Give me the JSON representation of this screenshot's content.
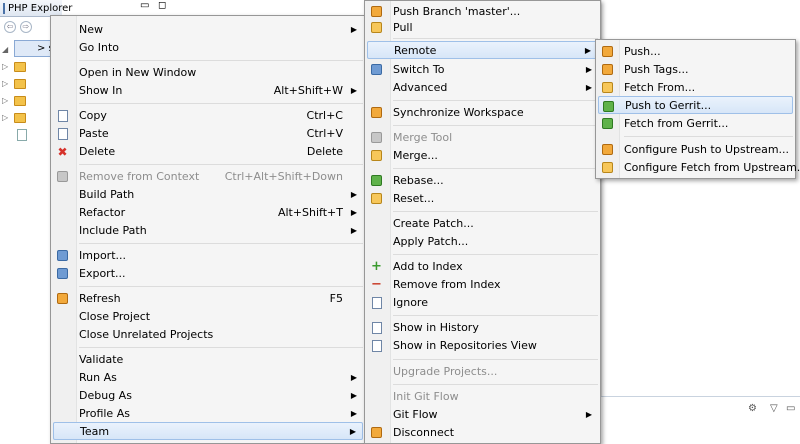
{
  "explorer": {
    "tab_title": "PHP Explorer",
    "selected_item_prefix": "> s",
    "tree_rows": 6
  },
  "main_menu": {
    "items": [
      {
        "label": "New",
        "shortcut": "",
        "submenu": true,
        "disabled": false,
        "icon": ""
      },
      {
        "label": "Go Into",
        "shortcut": "",
        "submenu": false,
        "disabled": false,
        "icon": ""
      },
      {
        "label": "Open in New Window",
        "shortcut": "",
        "submenu": false,
        "disabled": false,
        "icon": ""
      },
      {
        "label": "Show In",
        "shortcut": "Alt+Shift+W",
        "submenu": true,
        "disabled": false,
        "icon": ""
      },
      {
        "label": "Copy",
        "shortcut": "Ctrl+C",
        "submenu": false,
        "disabled": false,
        "icon": "copy-icon"
      },
      {
        "label": "Paste",
        "shortcut": "Ctrl+V",
        "submenu": false,
        "disabled": false,
        "icon": "paste-icon"
      },
      {
        "label": "Delete",
        "shortcut": "Delete",
        "submenu": false,
        "disabled": false,
        "icon": "delete-icon"
      },
      {
        "label": "Remove from Context",
        "shortcut": "Ctrl+Alt+Shift+Down",
        "submenu": false,
        "disabled": true,
        "icon": "remove-context-icon"
      },
      {
        "label": "Build Path",
        "shortcut": "",
        "submenu": true,
        "disabled": false,
        "icon": ""
      },
      {
        "label": "Refactor",
        "shortcut": "Alt+Shift+T",
        "submenu": true,
        "disabled": false,
        "icon": ""
      },
      {
        "label": "Include Path",
        "shortcut": "",
        "submenu": true,
        "disabled": false,
        "icon": ""
      },
      {
        "label": "Import...",
        "shortcut": "",
        "submenu": false,
        "disabled": false,
        "icon": "import-icon"
      },
      {
        "label": "Export...",
        "shortcut": "",
        "submenu": false,
        "disabled": false,
        "icon": "export-icon"
      },
      {
        "label": "Refresh",
        "shortcut": "F5",
        "submenu": false,
        "disabled": false,
        "icon": "refresh-icon"
      },
      {
        "label": "Close Project",
        "shortcut": "",
        "submenu": false,
        "disabled": false,
        "icon": ""
      },
      {
        "label": "Close Unrelated Projects",
        "shortcut": "",
        "submenu": false,
        "disabled": false,
        "icon": ""
      },
      {
        "label": "Validate",
        "shortcut": "",
        "submenu": false,
        "disabled": false,
        "icon": ""
      },
      {
        "label": "Run As",
        "shortcut": "",
        "submenu": true,
        "disabled": false,
        "icon": ""
      },
      {
        "label": "Debug As",
        "shortcut": "",
        "submenu": true,
        "disabled": false,
        "icon": ""
      },
      {
        "label": "Profile As",
        "shortcut": "",
        "submenu": true,
        "disabled": false,
        "icon": ""
      },
      {
        "label": "Team",
        "shortcut": "",
        "submenu": true,
        "disabled": false,
        "icon": "",
        "highlighted": true
      }
    ]
  },
  "team_menu": {
    "items": [
      {
        "label": "Push Branch 'master'...",
        "submenu": false,
        "disabled": false,
        "icon": "push-branch-icon"
      },
      {
        "label": "Pull",
        "submenu": false,
        "disabled": false,
        "icon": "pull-icon"
      },
      {
        "label": "Remote",
        "submenu": true,
        "disabled": false,
        "icon": "",
        "highlighted": true
      },
      {
        "label": "Switch To",
        "submenu": true,
        "disabled": false,
        "icon": "switch-branch-icon"
      },
      {
        "label": "Advanced",
        "submenu": true,
        "disabled": false,
        "icon": ""
      },
      {
        "label": "Synchronize Workspace",
        "submenu": false,
        "disabled": false,
        "icon": "synchronize-icon"
      },
      {
        "label": "Merge Tool",
        "submenu": false,
        "disabled": true,
        "icon": "merge-tool-icon"
      },
      {
        "label": "Merge...",
        "submenu": false,
        "disabled": false,
        "icon": "merge-icon"
      },
      {
        "label": "Rebase...",
        "submenu": false,
        "disabled": false,
        "icon": "rebase-icon"
      },
      {
        "label": "Reset...",
        "submenu": false,
        "disabled": false,
        "icon": "reset-icon"
      },
      {
        "label": "Create Patch...",
        "submenu": false,
        "disabled": false,
        "icon": ""
      },
      {
        "label": "Apply Patch...",
        "submenu": false,
        "disabled": false,
        "icon": ""
      },
      {
        "label": "Add to Index",
        "submenu": false,
        "disabled": false,
        "icon": "add-index-icon"
      },
      {
        "label": "Remove from Index",
        "submenu": false,
        "disabled": false,
        "icon": "remove-index-icon"
      },
      {
        "label": "Ignore",
        "submenu": false,
        "disabled": false,
        "icon": "ignore-icon"
      },
      {
        "label": "Show in History",
        "submenu": false,
        "disabled": false,
        "icon": "history-icon"
      },
      {
        "label": "Show in Repositories View",
        "submenu": false,
        "disabled": false,
        "icon": "repositories-icon"
      },
      {
        "label": "Upgrade Projects...",
        "submenu": false,
        "disabled": true,
        "icon": ""
      },
      {
        "label": "Init Git Flow",
        "submenu": false,
        "disabled": true,
        "icon": ""
      },
      {
        "label": "Git Flow",
        "submenu": true,
        "disabled": false,
        "icon": ""
      },
      {
        "label": "Disconnect",
        "submenu": false,
        "disabled": false,
        "icon": "disconnect-icon"
      }
    ]
  },
  "remote_menu": {
    "items": [
      {
        "label": "Push...",
        "icon": "push-icon"
      },
      {
        "label": "Push Tags...",
        "icon": "push-tags-icon"
      },
      {
        "label": "Fetch From...",
        "icon": "fetch-icon"
      },
      {
        "label": "Push to Gerrit...",
        "icon": "push-gerrit-icon",
        "highlighted": true
      },
      {
        "label": "Fetch from Gerrit...",
        "icon": "fetch-gerrit-icon"
      },
      {
        "label": "Configure Push to Upstream...",
        "icon": "configure-push-icon"
      },
      {
        "label": "Configure Fetch from Upstream...",
        "icon": "configure-fetch-icon"
      }
    ]
  },
  "colors": {
    "highlight": "#d7e6f8",
    "highlight_border": "#9fc0e8",
    "disabled_text": "#8d8d8d"
  }
}
